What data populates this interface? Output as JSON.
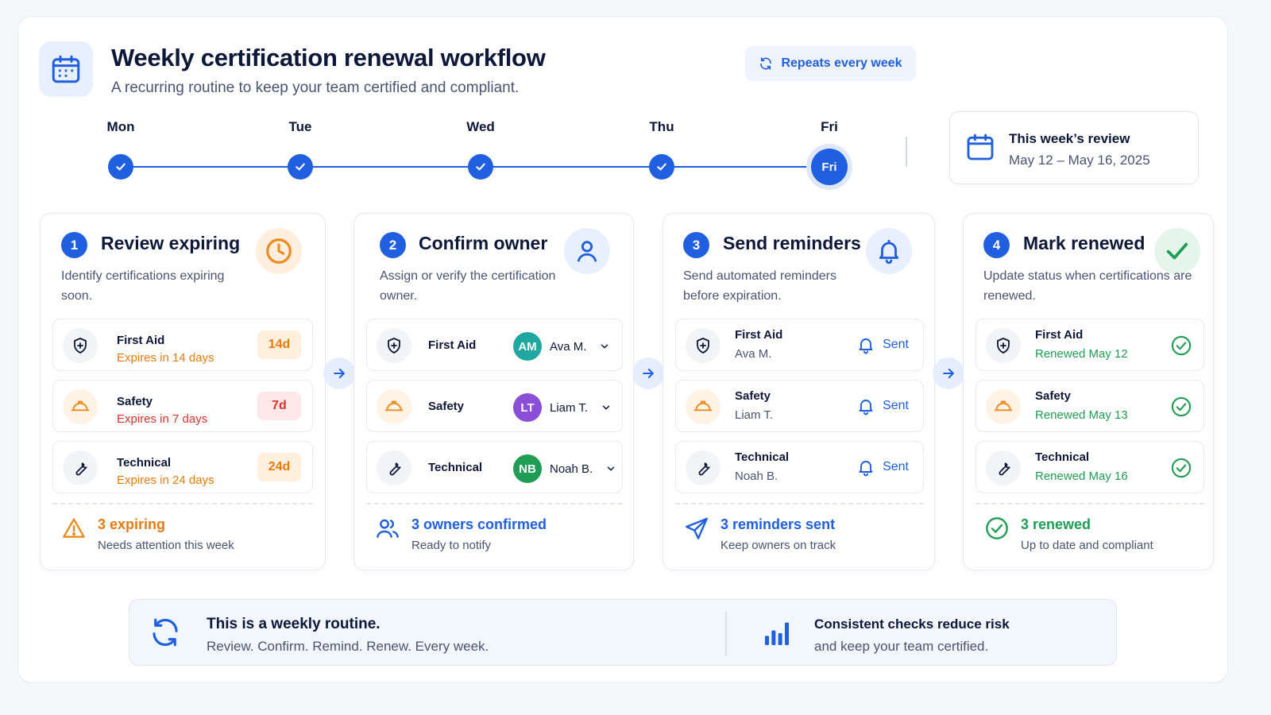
{
  "header": {
    "title": "Weekly certification renewal workflow",
    "subtitle": "A recurring routine to keep your team certified and compliant.",
    "repeat_label": "Repeats every week"
  },
  "timeline": {
    "days": [
      {
        "label": "Mon",
        "state": "done"
      },
      {
        "label": "Tue",
        "state": "done"
      },
      {
        "label": "Wed",
        "state": "done"
      },
      {
        "label": "Thu",
        "state": "done"
      },
      {
        "label": "Fri",
        "state": "current",
        "marker": "Fri"
      }
    ]
  },
  "review": {
    "title": "This week’s review",
    "dates": "May 12 – May 16, 2025"
  },
  "steps": [
    {
      "num": "1",
      "title": "Review expiring",
      "desc": "Identify certifications expiring soon.",
      "icon": "clock-icon",
      "rows": [
        {
          "name": "First Aid",
          "sub": "Expires in 14 days",
          "chip": "14d",
          "icon": "shield-icon"
        },
        {
          "name": "Safety",
          "sub": "Expires in 7 days",
          "chip": "7d",
          "icon": "hard-hat-icon"
        },
        {
          "name": "Technical",
          "sub": "Expires in 24 days",
          "chip": "24d",
          "icon": "wrench-icon"
        }
      ],
      "footer": {
        "title": "3 expiring",
        "sub": "Needs attention this week"
      }
    },
    {
      "num": "2",
      "title": "Confirm owner",
      "desc": "Assign or verify the certification owner.",
      "icon": "user-icon",
      "rows": [
        {
          "name": "First Aid",
          "initials": "AM",
          "owner": "Ava M.",
          "icon": "shield-icon"
        },
        {
          "name": "Safety",
          "initials": "LT",
          "owner": "Liam T.",
          "icon": "hard-hat-icon"
        },
        {
          "name": "Technical",
          "initials": "NB",
          "owner": "Noah B.",
          "icon": "wrench-icon"
        }
      ],
      "footer": {
        "title": "3 owners confirmed",
        "sub": "Ready to notify"
      }
    },
    {
      "num": "3",
      "title": "Send reminders",
      "desc": "Send automated reminders before expiration.",
      "icon": "bell-icon",
      "rows": [
        {
          "name": "First Aid",
          "owner": "Ava M.",
          "status": "Sent",
          "icon": "shield-icon"
        },
        {
          "name": "Safety",
          "owner": "Liam T.",
          "status": "Sent",
          "icon": "hard-hat-icon"
        },
        {
          "name": "Technical",
          "owner": "Noah B.",
          "status": "Sent",
          "icon": "wrench-icon"
        }
      ],
      "footer": {
        "title": "3 reminders sent",
        "sub": "Keep owners on track"
      }
    },
    {
      "num": "4",
      "title": "Mark renewed",
      "desc": "Update status when certifications are renewed.",
      "icon": "checkmark-icon",
      "rows": [
        {
          "name": "First Aid",
          "sub": "Renewed May 12",
          "icon": "shield-icon"
        },
        {
          "name": "Safety",
          "sub": "Renewed May 13",
          "icon": "hard-hat-icon"
        },
        {
          "name": "Technical",
          "sub": "Renewed May 16",
          "icon": "wrench-icon"
        }
      ],
      "footer": {
        "title": "3 renewed",
        "sub": "Up to date and compliant"
      }
    }
  ],
  "banner": {
    "left_title": "This is a weekly routine.",
    "left_sub": "Review. Confirm. Remind. Renew. Every week.",
    "right_title": "Consistent checks reduce risk",
    "right_sub": "and keep your team certified."
  },
  "colors": {
    "accent": "#1f5fe0",
    "orange": "#e97a10",
    "red": "#d9322f",
    "green": "#1f9d55",
    "avatar_am": "#1fa7a0",
    "avatar_lt": "#8a4fd6",
    "avatar_nb": "#1f9d55"
  }
}
